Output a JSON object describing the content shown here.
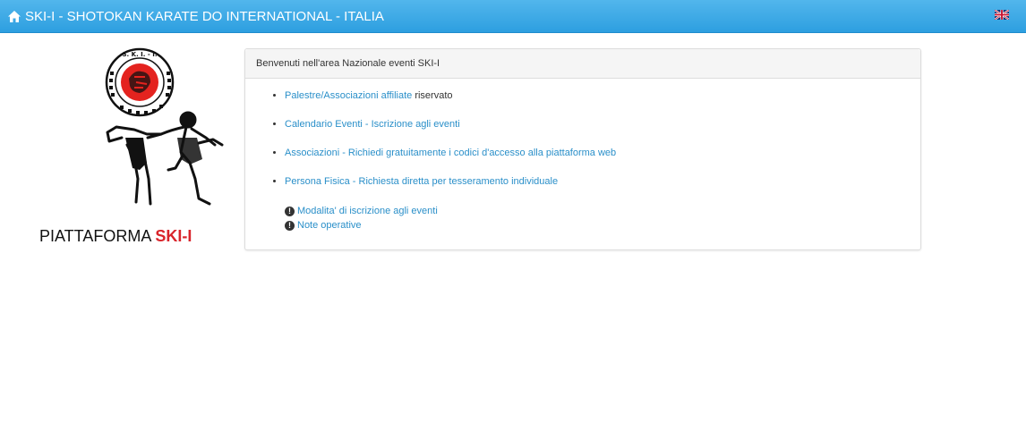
{
  "navbar": {
    "title": "SKI-I - SHOTOKAN KARATE DO INTERNATIONAL - ITALIA",
    "home_icon": "home-icon",
    "language_flag": "uk-flag-icon"
  },
  "logo": {
    "seal_text": "S. K. I. - I."
  },
  "platform": {
    "prefix": "PIATTAFORMA ",
    "name": "SKI-I"
  },
  "panel": {
    "heading": "Benvenuti nell'area Nazionale eventi SKI-I",
    "links": [
      {
        "label": "Palestre/Associazioni affiliate",
        "suffix": " riservato"
      },
      {
        "label": "Calendario Eventi - Iscrizione agli eventi"
      },
      {
        "label": "Associazioni - Richiedi gratuitamente i codici d'accesso alla piattaforma web"
      },
      {
        "label": "Persona Fisica - Richiesta diretta per tesseramento individuale"
      }
    ],
    "notes": [
      {
        "icon": "info-icon",
        "label": "Modalita' di iscrizione agli eventi"
      },
      {
        "icon": "info-icon",
        "label": "Note operative"
      }
    ]
  },
  "colors": {
    "navbar": "#3aa8e6",
    "link": "#2a8fc9",
    "brand_red": "#d9242b"
  }
}
